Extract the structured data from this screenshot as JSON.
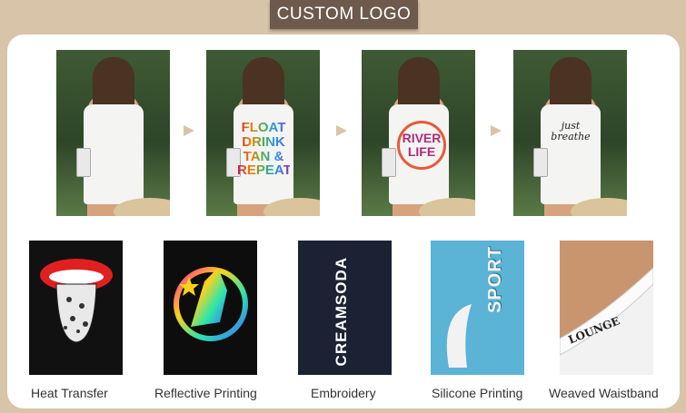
{
  "banner": {
    "title": "CUSTOM LOGO"
  },
  "shirts": [
    {
      "print": ""
    },
    {
      "print": "FLOAT DRINK TAN & REPEAT"
    },
    {
      "print": "RIVER LIFE"
    },
    {
      "print": "just breathe"
    }
  ],
  "techniques": [
    {
      "label": "Heat Transfer"
    },
    {
      "label": "Reflective Printing"
    },
    {
      "label": "Embroidery",
      "text": "CREAMSODA"
    },
    {
      "label": "Silicone Printing",
      "text": "SPORT"
    },
    {
      "label": "Weaved Waistband",
      "text": "LOUNGE"
    }
  ]
}
